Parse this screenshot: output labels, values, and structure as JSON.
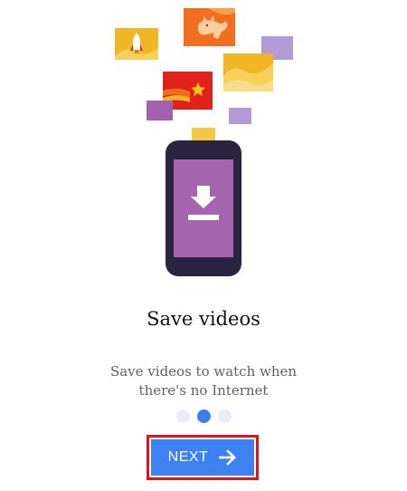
{
  "onboarding": {
    "title": "Save videos",
    "description": "Save videos to watch when there's no Internet",
    "page_indicator": {
      "total": 3,
      "current": 2
    },
    "next_label": "NEXT"
  },
  "colors": {
    "accent": "#3d82f2",
    "active_dot": "#3d7fe6",
    "inactive_dot": "#e8edf6",
    "highlight_outline": "#e0121c",
    "phone_body": "#2b2440",
    "phone_screen": "#a564ae",
    "card_yellow": "#f2b625",
    "card_orange": "#f26f22",
    "card_red": "#e1221b",
    "card_purple_light": "#b39ad6",
    "card_purple": "#a262ae"
  },
  "icons": {
    "download": "download-icon",
    "next_arrow": "arrow-right-icon"
  }
}
